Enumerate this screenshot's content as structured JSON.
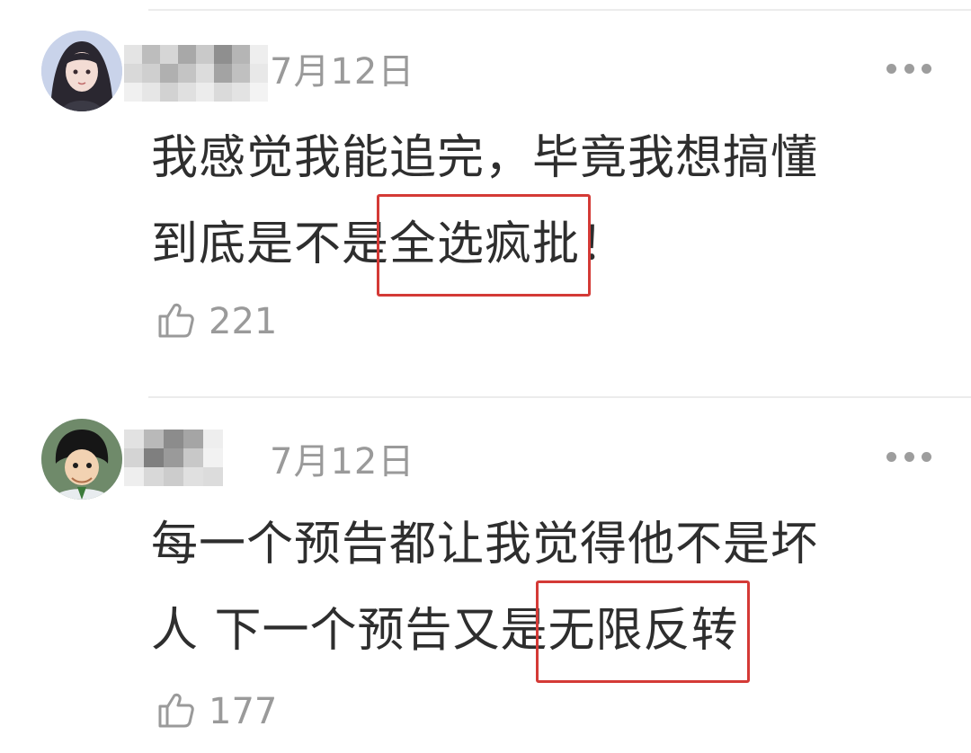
{
  "comments": [
    {
      "date": "7月12日",
      "text_line1": "我感觉我能追完，毕竟我想搞懂",
      "text_line2_pre": "到底是不是",
      "text_line2_highlight": "全选疯批",
      "text_line2_post": "！",
      "likes": "221",
      "avatar_icon": "girl-avatar-icon",
      "like_icon": "thumbs-up-icon",
      "more_icon": "more-dots-icon"
    },
    {
      "date": "7月12日",
      "text_line1": "每一个预告都让我觉得他不是坏",
      "text_line2_pre": "人 下一个预告又是",
      "text_line2_highlight": "无限反转",
      "text_line2_post": "",
      "likes": "177",
      "avatar_icon": "anime-boy-avatar-icon",
      "like_icon": "thumbs-up-icon",
      "more_icon": "more-dots-icon"
    }
  ],
  "colors": {
    "highlight_border": "#d43a36",
    "meta_text": "#9a9a9a",
    "body_text": "#2e2e2e"
  }
}
